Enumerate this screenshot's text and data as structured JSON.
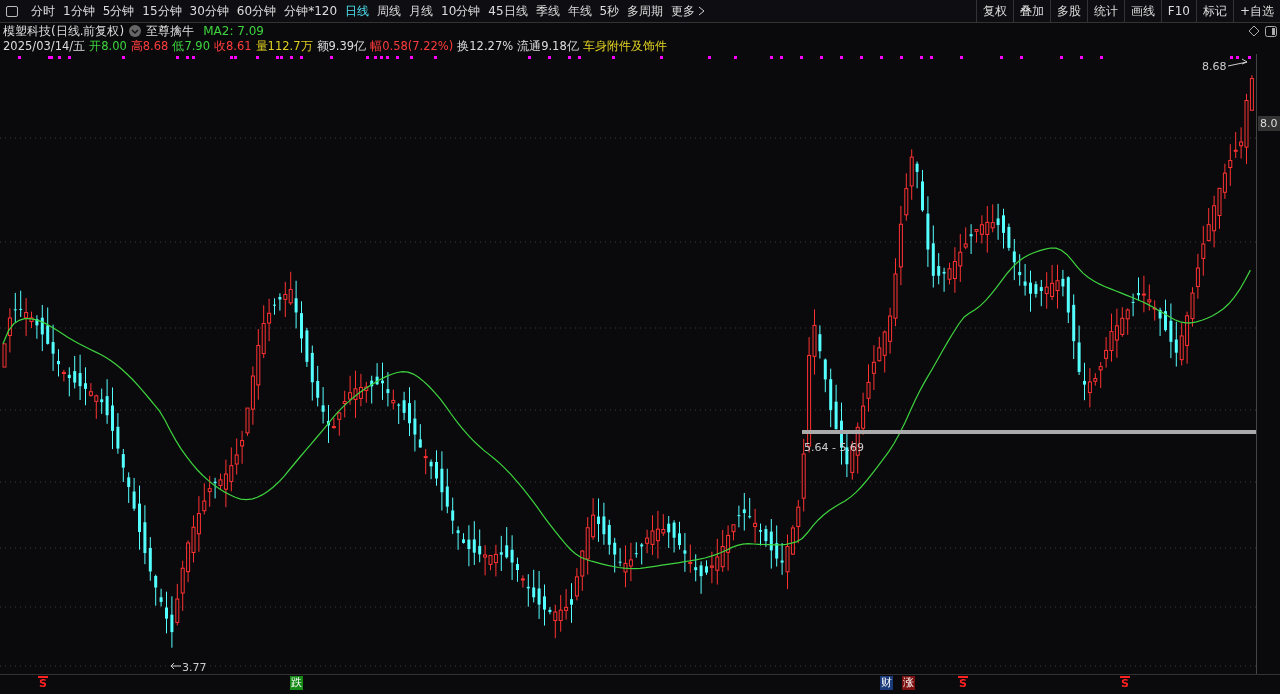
{
  "toolbar": {
    "periods": [
      {
        "label": "分时",
        "selected": false
      },
      {
        "label": "1分钟",
        "selected": false
      },
      {
        "label": "5分钟",
        "selected": false
      },
      {
        "label": "15分钟",
        "selected": false
      },
      {
        "label": "30分钟",
        "selected": false
      },
      {
        "label": "60分钟",
        "selected": false
      },
      {
        "label": "分钟*120",
        "selected": false
      },
      {
        "label": "日线",
        "selected": true
      },
      {
        "label": "周线",
        "selected": false
      },
      {
        "label": "月线",
        "selected": false
      },
      {
        "label": "10分钟",
        "selected": false
      },
      {
        "label": "45日线",
        "selected": false
      },
      {
        "label": "季线",
        "selected": false
      },
      {
        "label": "年线",
        "selected": false
      },
      {
        "label": "5秒",
        "selected": false
      },
      {
        "label": "多周期",
        "selected": false
      }
    ],
    "more": "更多",
    "buttons": [
      "复权",
      "叠加",
      "多股",
      "统计",
      "画线",
      "F10",
      "标记",
      "+自选"
    ]
  },
  "header": {
    "title": "模塑科技(日线.前复权)",
    "indicator": "至尊擒牛",
    "ma": "MA2: 7.09"
  },
  "quote": [
    {
      "text": "2025/03/14/五",
      "kind": "plain"
    },
    {
      "text": "开8.00",
      "kind": "down"
    },
    {
      "text": "高8.68",
      "kind": "up"
    },
    {
      "text": "低7.90",
      "kind": "down"
    },
    {
      "text": "收8.61",
      "kind": "up"
    },
    {
      "text": "量112.7万",
      "kind": "volume"
    },
    {
      "text": "额9.39亿",
      "kind": "plain"
    },
    {
      "text": "幅0.58(7.22%)",
      "kind": "up"
    },
    {
      "text": "换12.27%",
      "kind": "plain"
    },
    {
      "text": "流通9.18亿",
      "kind": "plain"
    },
    {
      "text": "车身附件及饰件",
      "kind": "volume"
    }
  ],
  "chart": {
    "high_label": "8.68",
    "low_label": "3.77",
    "range_label": "5.64 - 5.69",
    "axis_price": "8.0"
  },
  "signals": [
    {
      "text": "S",
      "kind": "s"
    },
    {
      "text": "跌",
      "kind": "fall"
    },
    {
      "text": "财",
      "kind": "finance"
    },
    {
      "text": "涨",
      "kind": "rise"
    },
    {
      "text": "S",
      "kind": "s"
    },
    {
      "text": "S",
      "kind": "s"
    }
  ]
}
